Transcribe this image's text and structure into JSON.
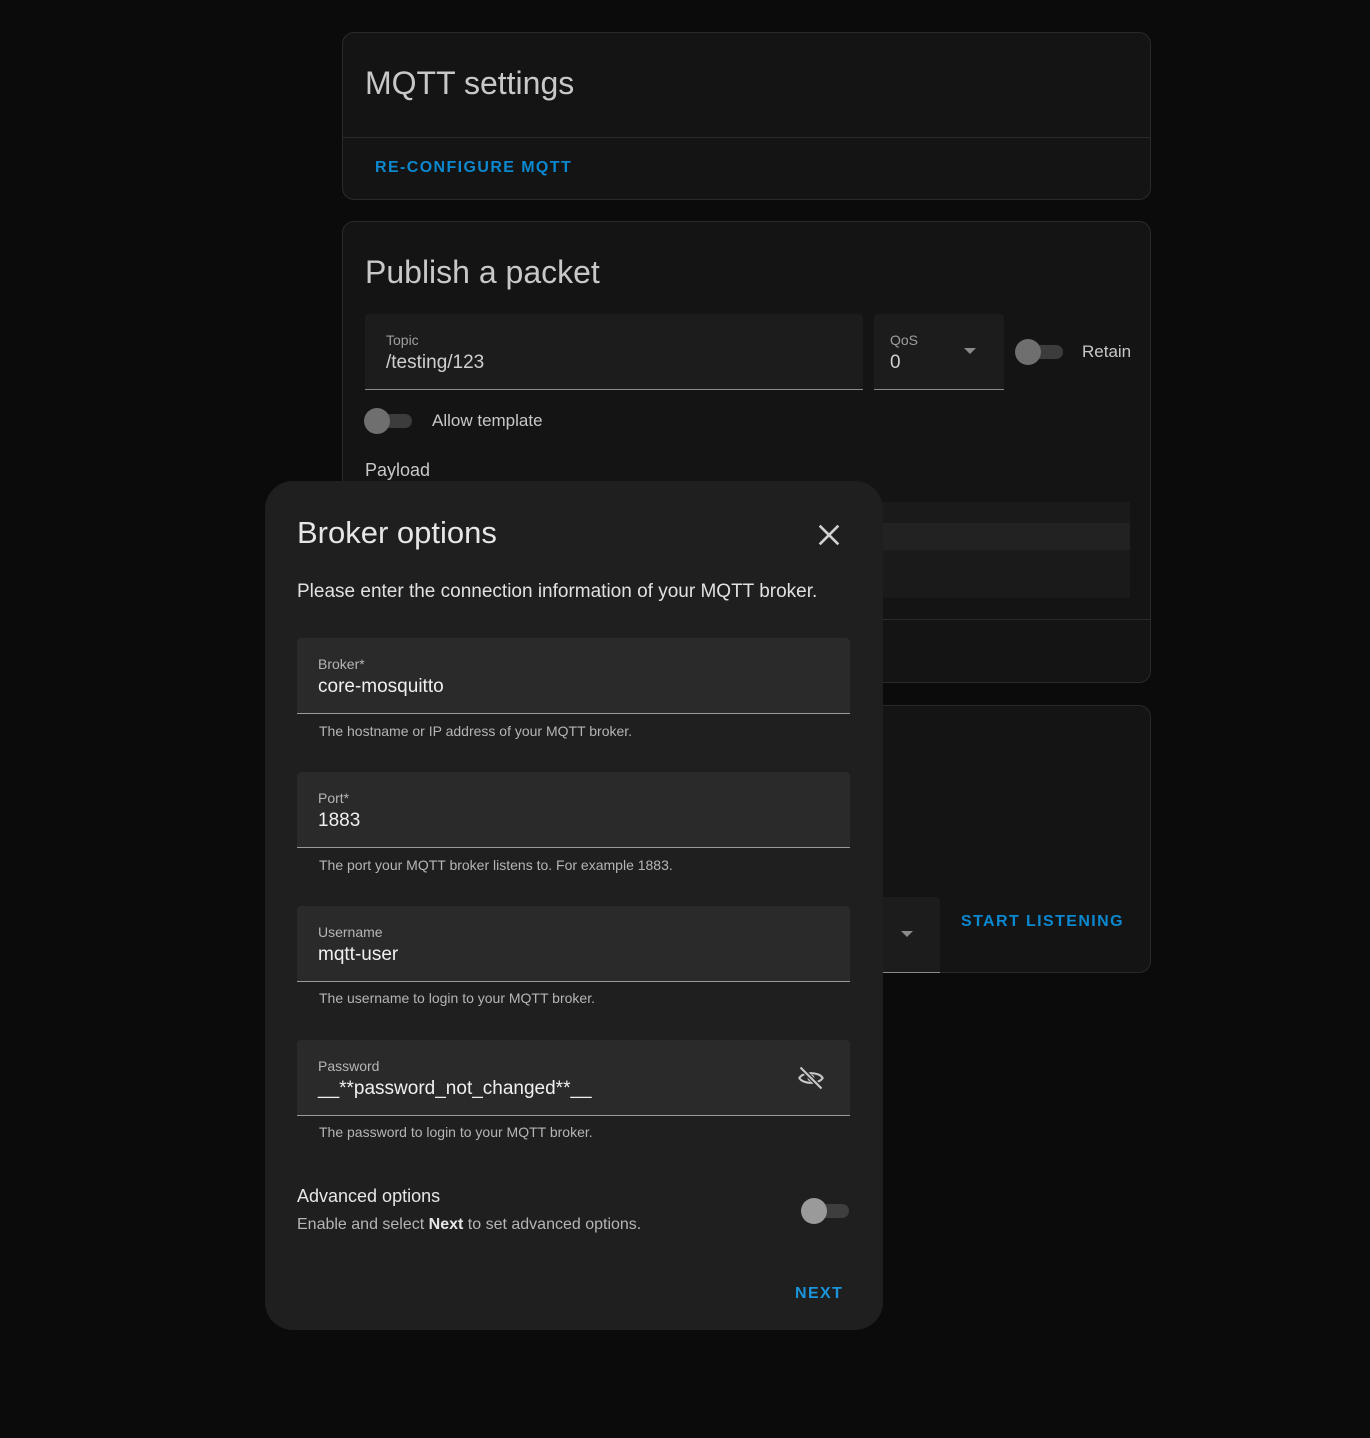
{
  "mqtt_settings": {
    "title": "MQTT settings",
    "reconfigure_label": "RE-CONFIGURE MQTT"
  },
  "publish": {
    "title": "Publish a packet",
    "topic_label": "Topic",
    "topic_value": "/testing/123",
    "qos_label": "QoS",
    "qos_value": "0",
    "retain_label": "Retain",
    "allow_template_label": "Allow template",
    "payload_label": "Payload"
  },
  "listen": {
    "start_listening_label": "START LISTENING"
  },
  "dialog": {
    "title": "Broker options",
    "description": "Please enter the connection information of your MQTT broker.",
    "broker": {
      "label": "Broker*",
      "value": "core-mosquitto",
      "helper": "The hostname or IP address of your MQTT broker."
    },
    "port": {
      "label": "Port*",
      "value": "1883",
      "helper": "The port your MQTT broker listens to. For example 1883."
    },
    "username": {
      "label": "Username",
      "value": "mqtt-user",
      "helper": "The username to login to your MQTT broker."
    },
    "password": {
      "label": "Password",
      "value": "__**password_not_changed**__",
      "helper": "The password to login to your MQTT broker."
    },
    "advanced": {
      "title": "Advanced options",
      "desc_prefix": "Enable and select ",
      "desc_bold": "Next",
      "desc_suffix": " to set advanced options."
    },
    "next_label": "NEXT"
  },
  "colors": {
    "accent": "#0b88cf",
    "background": "#0b0b0b",
    "card": "#141414",
    "dialog": "#1f1f1f"
  },
  "icons": {
    "close": "close-icon",
    "password_visibility": "eye-off-icon",
    "dropdown": "chevron-down-icon"
  }
}
